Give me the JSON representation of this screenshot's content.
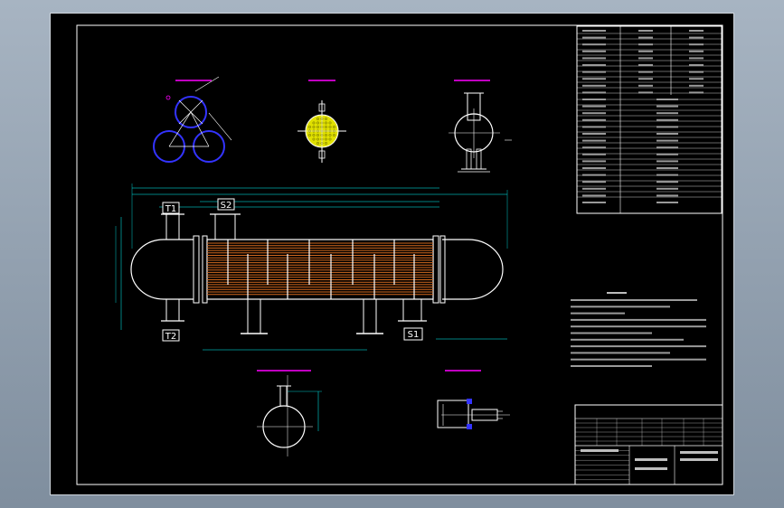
{
  "nozzle_tags": {
    "t1": "T1",
    "s2": "S2",
    "t2": "T2",
    "s1": "S1"
  },
  "colors": {
    "background": "#000000",
    "frame": "#ffffff",
    "tubes": "#d2691e",
    "baffles": "#ffffff",
    "section_labels": "#ff00ff",
    "dimensions": "#00ffff",
    "circles": "#3333ff",
    "tube_sheet": "#e0e000",
    "highlight": "#ffff00"
  },
  "icons": [
    "tube-bundle",
    "nozzle",
    "saddle-support",
    "tube-sheet",
    "flange"
  ]
}
